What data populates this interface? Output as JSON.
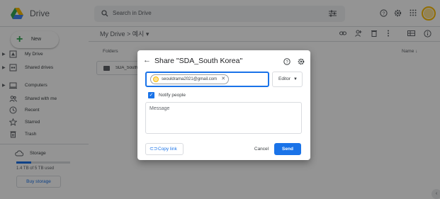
{
  "header": {
    "app_title": "Drive",
    "search_placeholder": "Search in Drive"
  },
  "sidebar": {
    "new_label": "New",
    "items": [
      {
        "label": "My Drive",
        "icon": "my-drive-icon"
      },
      {
        "label": "Shared drives",
        "icon": "shared-drives-icon"
      },
      {
        "label": "Computers",
        "icon": "computers-icon"
      },
      {
        "label": "Shared with me",
        "icon": "shared-with-me-icon"
      },
      {
        "label": "Recent",
        "icon": "recent-icon"
      },
      {
        "label": "Starred",
        "icon": "star-icon"
      },
      {
        "label": "Trash",
        "icon": "trash-icon"
      }
    ],
    "storage_label": "Storage",
    "quota_text": "1.4 TB of 5 TB used",
    "quota_fraction": 0.28,
    "buy_label": "Buy storage"
  },
  "main": {
    "breadcrumb": "My Drive  >  예시  ▾",
    "folders_label": "Folders",
    "name_sort_label": "Name  ↓",
    "folder_name": "SDA_South Korea"
  },
  "dialog": {
    "title": "Share \"SDA_South Korea\"",
    "recipient_email": "seouldrama2021@gmail.com",
    "role": "Editor",
    "notify_label": "Notify people",
    "notify_checked": true,
    "message_placeholder": "Message",
    "copy_link_label": "Copy link",
    "cancel_label": "Cancel",
    "send_label": "Send"
  },
  "colors": {
    "accent": "#1a73e8",
    "avatar_ring": "#fbbc04"
  }
}
